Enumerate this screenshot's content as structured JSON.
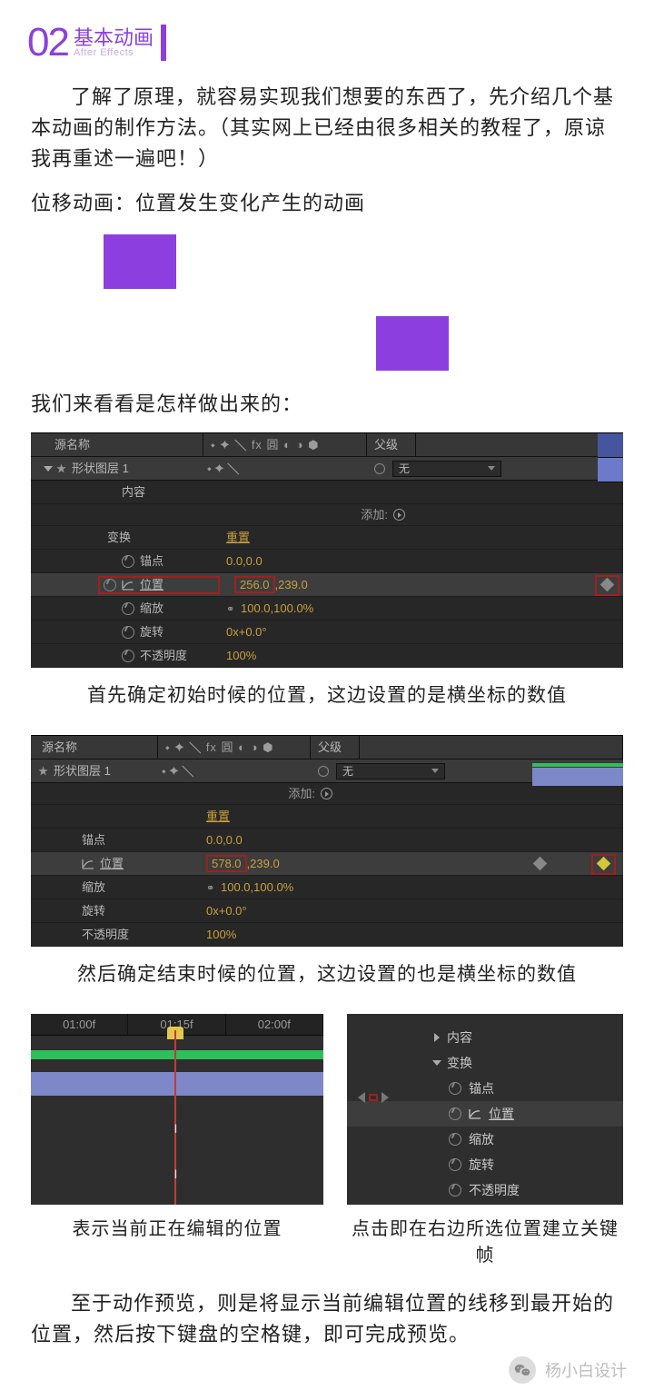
{
  "section": {
    "num": "02",
    "title": "基本动画",
    "sub": "After Effects"
  },
  "intro": "了解了原理，就容易实现我们想要的东西了，先介绍几个基本动画的制作方法。（其实网上已经由很多相关的教程了，原谅我再重述一遍吧！）",
  "h_translate": "位移动画：位置发生变化产生的动画",
  "lets_see": "我们来看看是怎样做出来的：",
  "ae": {
    "hdr_src": "源名称",
    "hdr_fx": "⬩ ✦ ╲ fx 圓 ◐ ◑ ⬢",
    "hdr_parent": "父级",
    "layer_name": "形状图层 1",
    "parent_none": "无",
    "add_label": "添加:",
    "group_content": "内容",
    "group_transform": "变换",
    "reset": "重置",
    "p_anchor": "锚点",
    "p_position": "位置",
    "p_scale": "缩放",
    "p_rotation": "旋转",
    "p_opacity": "不透明度",
    "v_anchor": "0.0,0.0",
    "v_pos1a": "256.0",
    "v_pos1b": ",239.0",
    "v_pos2a": "578.0",
    "v_pos2b": ",239.0",
    "v_scale": "100.0,100.0%",
    "v_rot": "0x+0.0°",
    "v_opac": "100%"
  },
  "cap1": "首先确定初始时候的位置，这边设置的是横坐标的数值",
  "cap2": "然后确定结束时候的位置，这边设置的也是横坐标的数值",
  "timeline": {
    "t1": "01:00f",
    "t2": "01:15f",
    "t3": "02:00f"
  },
  "cap3_left": "表示当前正在编辑的位置",
  "cap3_right": "点击即在右边所选位置建立关键帧",
  "outro": "至于动作预览，则是将显示当前编辑位置的线移到最开始的位置，然后按下键盘的空格键，即可完成预览。",
  "watermark": "杨小白设计"
}
